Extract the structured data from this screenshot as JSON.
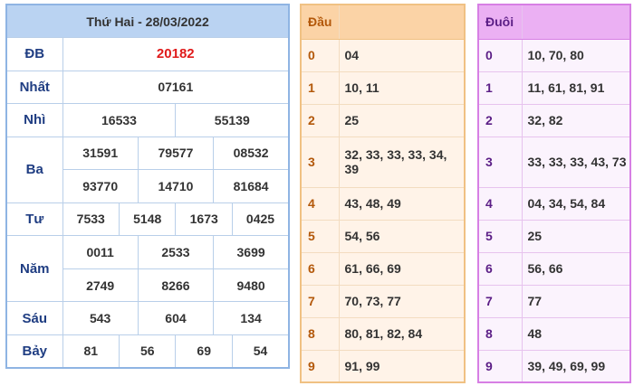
{
  "results": {
    "title": "Thứ Hai - 28/03/2022",
    "db": {
      "label": "ĐB",
      "values": [
        "20182"
      ]
    },
    "nhat": {
      "label": "Nhất",
      "values": [
        "07161"
      ]
    },
    "nhi": {
      "label": "Nhì",
      "values": [
        "16533",
        "55139"
      ]
    },
    "ba": {
      "label": "Ba",
      "values": [
        "31591",
        "79577",
        "08532",
        "93770",
        "14710",
        "81684"
      ]
    },
    "tu": {
      "label": "Tư",
      "values": [
        "7533",
        "5148",
        "1673",
        "0425"
      ]
    },
    "nam": {
      "label": "Năm",
      "values": [
        "0011",
        "2533",
        "3699",
        "2749",
        "8266",
        "9480"
      ]
    },
    "sau": {
      "label": "Sáu",
      "values": [
        "543",
        "604",
        "134"
      ]
    },
    "bay": {
      "label": "Bảy",
      "values": [
        "81",
        "56",
        "69",
        "54"
      ]
    }
  },
  "dau": {
    "title": "Đầu",
    "rows": [
      {
        "key": "0",
        "values": "04"
      },
      {
        "key": "1",
        "values": "10, 11"
      },
      {
        "key": "2",
        "values": "25"
      },
      {
        "key": "3",
        "values": "32, 33, 33, 33, 34, 39"
      },
      {
        "key": "4",
        "values": "43, 48, 49"
      },
      {
        "key": "5",
        "values": "54, 56"
      },
      {
        "key": "6",
        "values": "61, 66, 69"
      },
      {
        "key": "7",
        "values": "70, 73, 77"
      },
      {
        "key": "8",
        "values": "80, 81, 82, 84"
      },
      {
        "key": "9",
        "values": "91, 99"
      }
    ]
  },
  "duoi": {
    "title": "Đuôi",
    "rows": [
      {
        "key": "0",
        "values": "10, 70, 80"
      },
      {
        "key": "1",
        "values": "11, 61, 81, 91"
      },
      {
        "key": "2",
        "values": "32, 82"
      },
      {
        "key": "3",
        "values": "33, 33, 33, 43, 73"
      },
      {
        "key": "4",
        "values": "04, 34, 54, 84"
      },
      {
        "key": "5",
        "values": "25"
      },
      {
        "key": "6",
        "values": "56, 66"
      },
      {
        "key": "7",
        "values": "77"
      },
      {
        "key": "8",
        "values": "48"
      },
      {
        "key": "9",
        "values": "39, 49, 69, 99"
      }
    ]
  },
  "colors": {
    "results_header": "#bad3f2",
    "results_border": "#8fb4e3",
    "special_prize": "#e01b1b",
    "label_blue": "#1f3d82",
    "dau_header": "#fbd3a6",
    "dau_key": "#b3580a",
    "duoi_header": "#ebb0f3",
    "duoi_key": "#5b1e86"
  }
}
